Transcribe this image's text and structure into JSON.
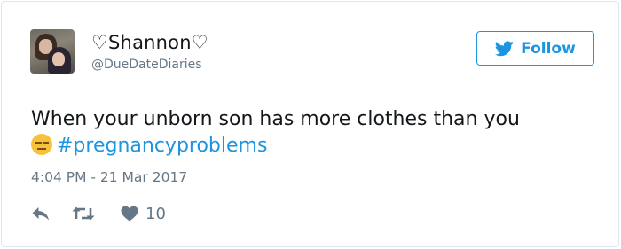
{
  "user": {
    "display_name": "♡Shannon♡",
    "handle": "@DueDateDiaries",
    "avatar_icon": "profile-photo"
  },
  "follow_button": {
    "label": "Follow",
    "icon": "twitter-bird-icon",
    "color": "#1b95e0"
  },
  "tweet": {
    "line1": "When your unborn son has more clothes than you",
    "emoji": "expressionless-face-emoji",
    "hashtag": "#pregnancyproblems",
    "timestamp": "4:04 PM - 21 Mar 2017"
  },
  "actions": {
    "reply_icon": "reply-icon",
    "retweet_icon": "retweet-icon",
    "like_icon": "heart-icon",
    "like_count": "10"
  },
  "colors": {
    "text": "#14171a",
    "secondary": "#657786",
    "link": "#1b95e0",
    "border": "#e1e8ed"
  }
}
